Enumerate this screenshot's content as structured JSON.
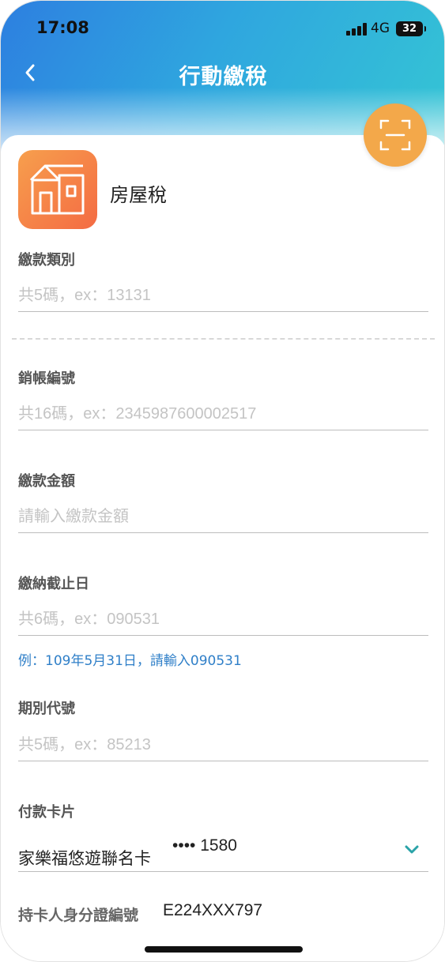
{
  "status_bar": {
    "time": "17:08",
    "network": "4G",
    "battery": "32"
  },
  "nav": {
    "title": "行動繳稅",
    "back_icon": "chevron-left-icon",
    "scan_icon": "scan-icon"
  },
  "tax": {
    "name": "房屋稅",
    "icon": "house-icon"
  },
  "fields": {
    "category": {
      "label": "繳款類別",
      "placeholder": "共5碼，ex：13131",
      "value": ""
    },
    "account": {
      "label": "銷帳編號",
      "placeholder": "共16碼，ex：2345987600002517",
      "value": ""
    },
    "amount": {
      "label": "繳款金額",
      "placeholder": "請輸入繳款金額",
      "value": ""
    },
    "deadline": {
      "label": "繳納截止日",
      "placeholder": "共6碼，ex：090531",
      "value": "",
      "hint": "例：109年5月31日，請輸入090531"
    },
    "period": {
      "label": "期別代號",
      "placeholder": "共5碼，ex：85213",
      "value": ""
    }
  },
  "payment_card": {
    "label": "付款卡片",
    "card_name": "家樂福悠遊聯名卡",
    "card_number": "•••• 1580"
  },
  "holder": {
    "label": "持卡人身分證編號",
    "value": "E224XXX797"
  },
  "colors": {
    "header_start": "#2d7fe0",
    "header_end": "#35c6d4",
    "scan_button": "#f3a84a",
    "tax_icon_start": "#f79f4d",
    "tax_icon_end": "#f46b43",
    "hint": "#2f7fc8",
    "chevron": "#2aa3a8"
  }
}
